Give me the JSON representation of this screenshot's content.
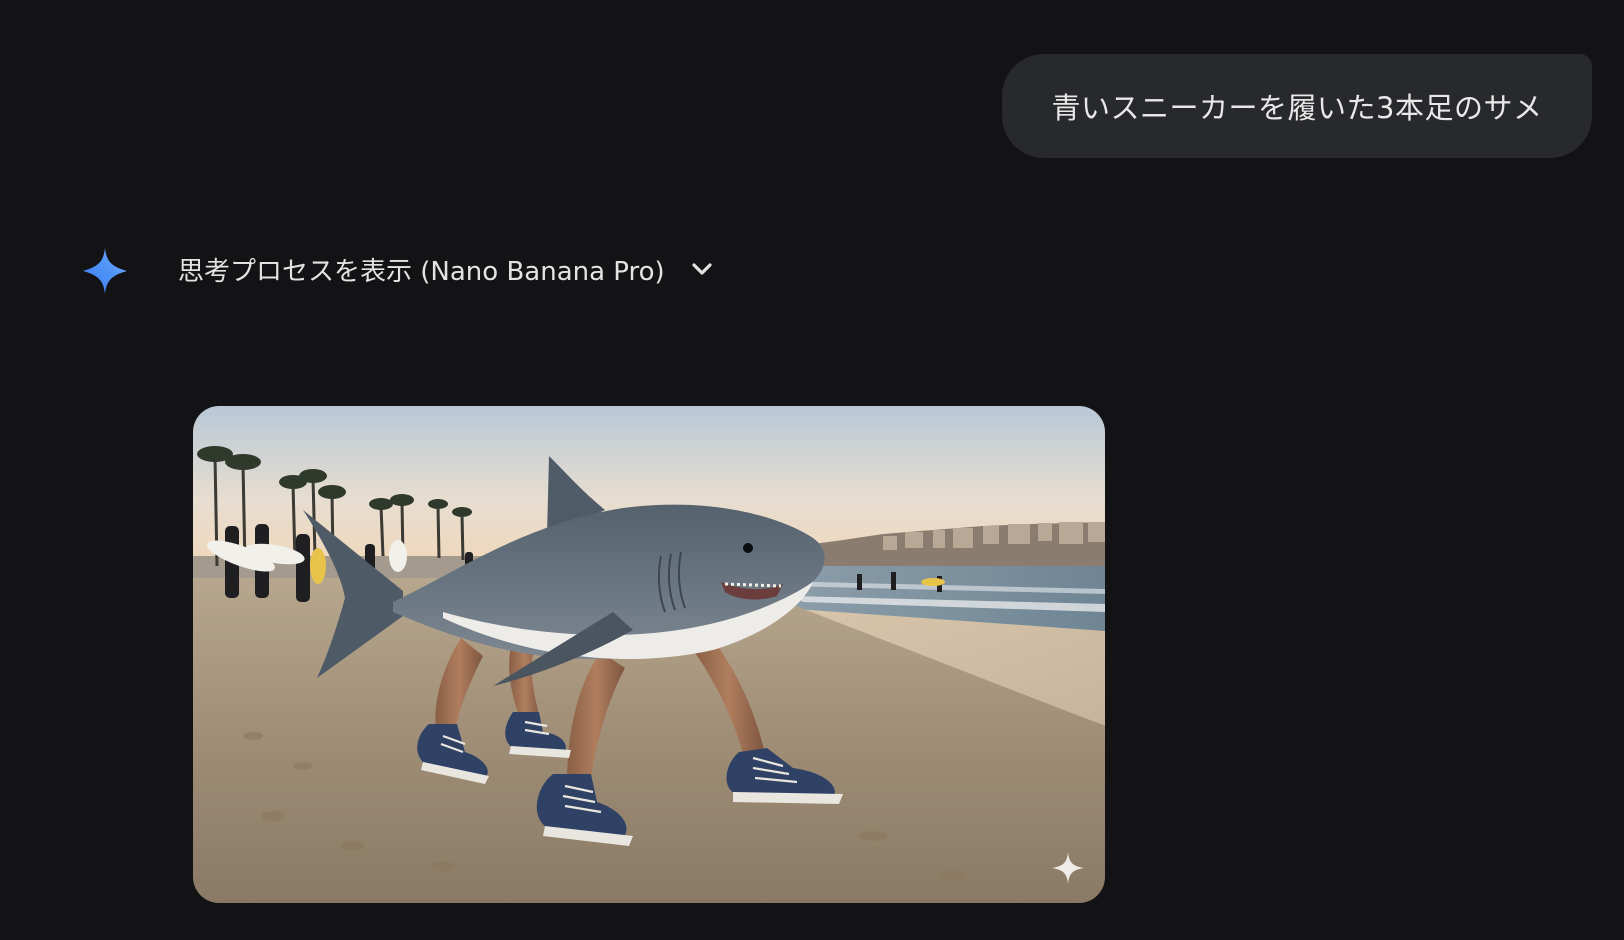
{
  "conversation": {
    "user_prompt": "青いスニーカーを履いた3本足のサメ",
    "response": {
      "thinking_label": "思考プロセスを表示 (Nano Banana Pro)",
      "expand_icon": "chevron-down-icon",
      "avatar_icon": "gemini-sparkle-icon",
      "image": {
        "watermark_icon": "sparkle-watermark-icon"
      }
    }
  },
  "colors": {
    "background": "#131316",
    "bubble": "#28292c",
    "gemini_blue": "#4c8df6"
  }
}
